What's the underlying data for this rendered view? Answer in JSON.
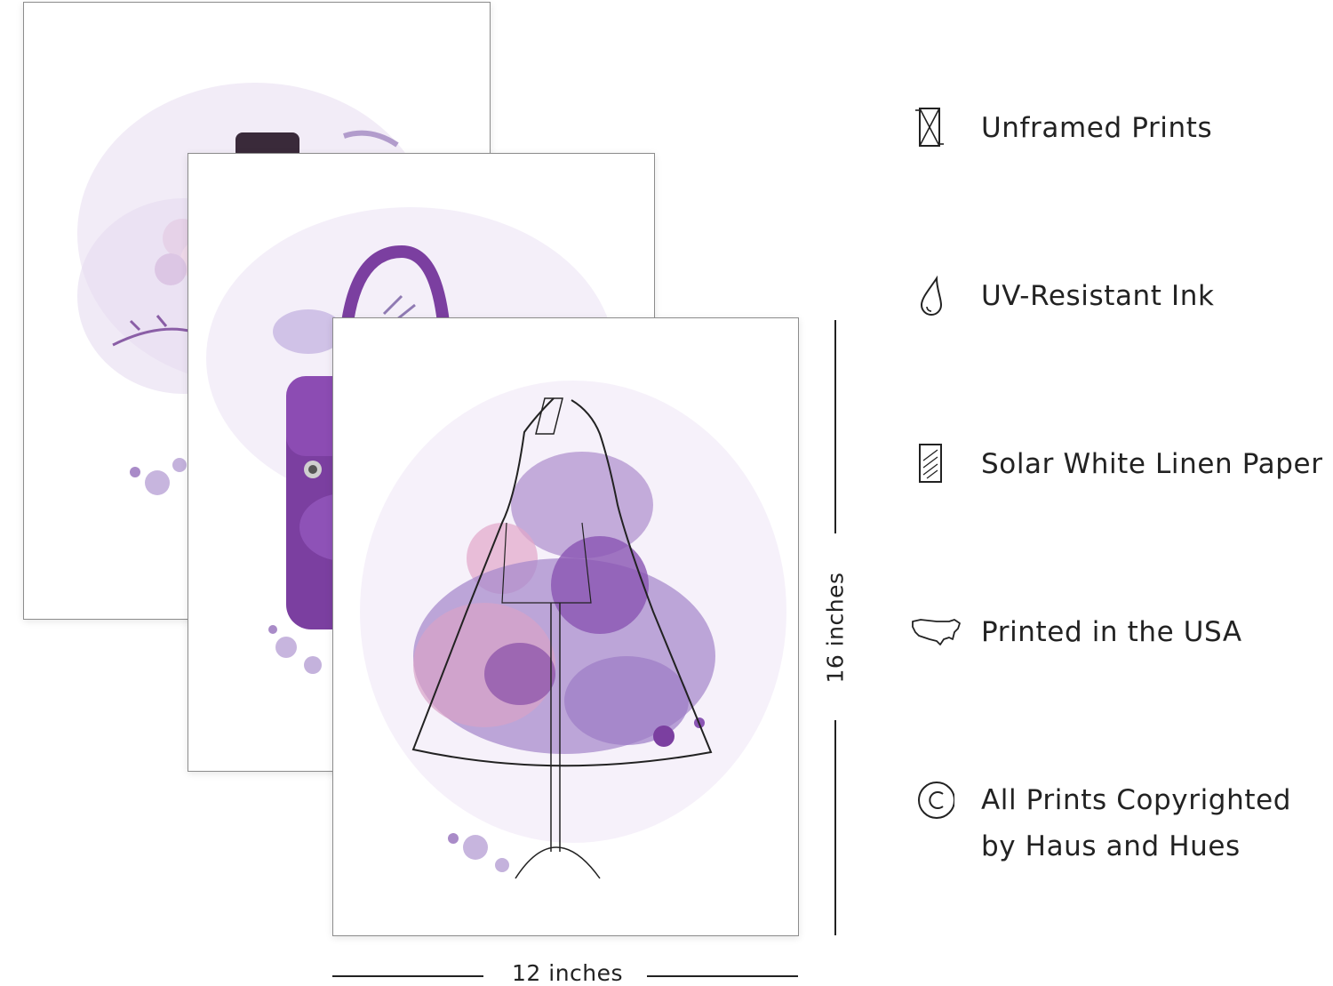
{
  "features": [
    {
      "icon": "unframed-icon",
      "label": "Unframed Prints"
    },
    {
      "icon": "ink-drop-icon",
      "label": "UV-Resistant Ink"
    },
    {
      "icon": "linen-paper-icon",
      "label": "Solar White Linen Paper"
    },
    {
      "icon": "usa-map-icon",
      "label": "Printed in the USA"
    },
    {
      "icon": "copyright-icon",
      "label_line1": "All Prints Copyrighted",
      "label_line2": "by Haus and Hues"
    }
  ],
  "dimensions": {
    "width": "12 inches",
    "height": "16 inches"
  },
  "colors": {
    "accent_purple": "#7b3fa0",
    "light_purple": "#b9a2d6",
    "pink": "#d9a3c7"
  }
}
